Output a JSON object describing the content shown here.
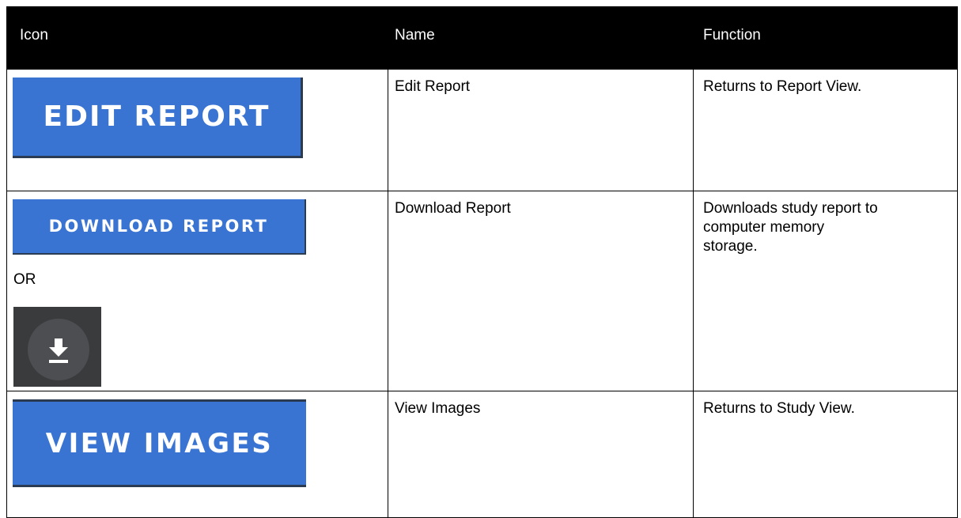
{
  "table": {
    "headers": {
      "icon": "Icon",
      "name": "Name",
      "function": "Function"
    },
    "rows": [
      {
        "button_label": "EDIT REPORT",
        "name": "Edit Report",
        "function": "Returns to Report View."
      },
      {
        "button_label": "DOWNLOAD REPORT",
        "or_label": "OR",
        "alt_icon": "download-icon",
        "name": "Download Report",
        "function": "Downloads study report to\ncomputer memory\nstorage."
      },
      {
        "button_label": "VIEW IMAGES",
        "name": "View Images",
        "function": "Returns to Study View."
      }
    ]
  },
  "colors": {
    "header_background": "#000000",
    "button_blue": "#3a74d2",
    "icon_background": "#3a3b3d",
    "icon_circle": "#4d4e51"
  }
}
